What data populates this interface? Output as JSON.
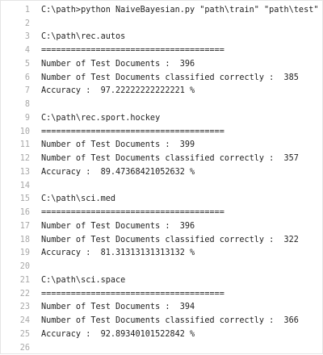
{
  "lines": [
    {
      "num": "1",
      "text": "C:\\path>python NaiveBayesian.py \"path\\train\" \"path\\test\""
    },
    {
      "num": "2",
      "text": ""
    },
    {
      "num": "3",
      "text": "C:\\path\\rec.autos"
    },
    {
      "num": "4",
      "text": "====================================="
    },
    {
      "num": "5",
      "text": "Number of Test Documents :  396"
    },
    {
      "num": "6",
      "text": "Number of Test Documents classified correctly :  385"
    },
    {
      "num": "7",
      "text": "Accuracy :  97.22222222222221 %"
    },
    {
      "num": "8",
      "text": ""
    },
    {
      "num": "9",
      "text": "C:\\path\\rec.sport.hockey"
    },
    {
      "num": "10",
      "text": "====================================="
    },
    {
      "num": "11",
      "text": "Number of Test Documents :  399"
    },
    {
      "num": "12",
      "text": "Number of Test Documents classified correctly :  357"
    },
    {
      "num": "13",
      "text": "Accuracy :  89.47368421052632 %"
    },
    {
      "num": "14",
      "text": ""
    },
    {
      "num": "15",
      "text": "C:\\path\\sci.med"
    },
    {
      "num": "16",
      "text": "====================================="
    },
    {
      "num": "17",
      "text": "Number of Test Documents :  396"
    },
    {
      "num": "18",
      "text": "Number of Test Documents classified correctly :  322"
    },
    {
      "num": "19",
      "text": "Accuracy :  81.31313131313132 %"
    },
    {
      "num": "20",
      "text": ""
    },
    {
      "num": "21",
      "text": "C:\\path\\sci.space"
    },
    {
      "num": "22",
      "text": "====================================="
    },
    {
      "num": "23",
      "text": "Number of Test Documents :  394"
    },
    {
      "num": "24",
      "text": "Number of Test Documents classified correctly :  366"
    },
    {
      "num": "25",
      "text": "Accuracy :  92.89340101522842 %"
    },
    {
      "num": "26",
      "text": ""
    }
  ]
}
